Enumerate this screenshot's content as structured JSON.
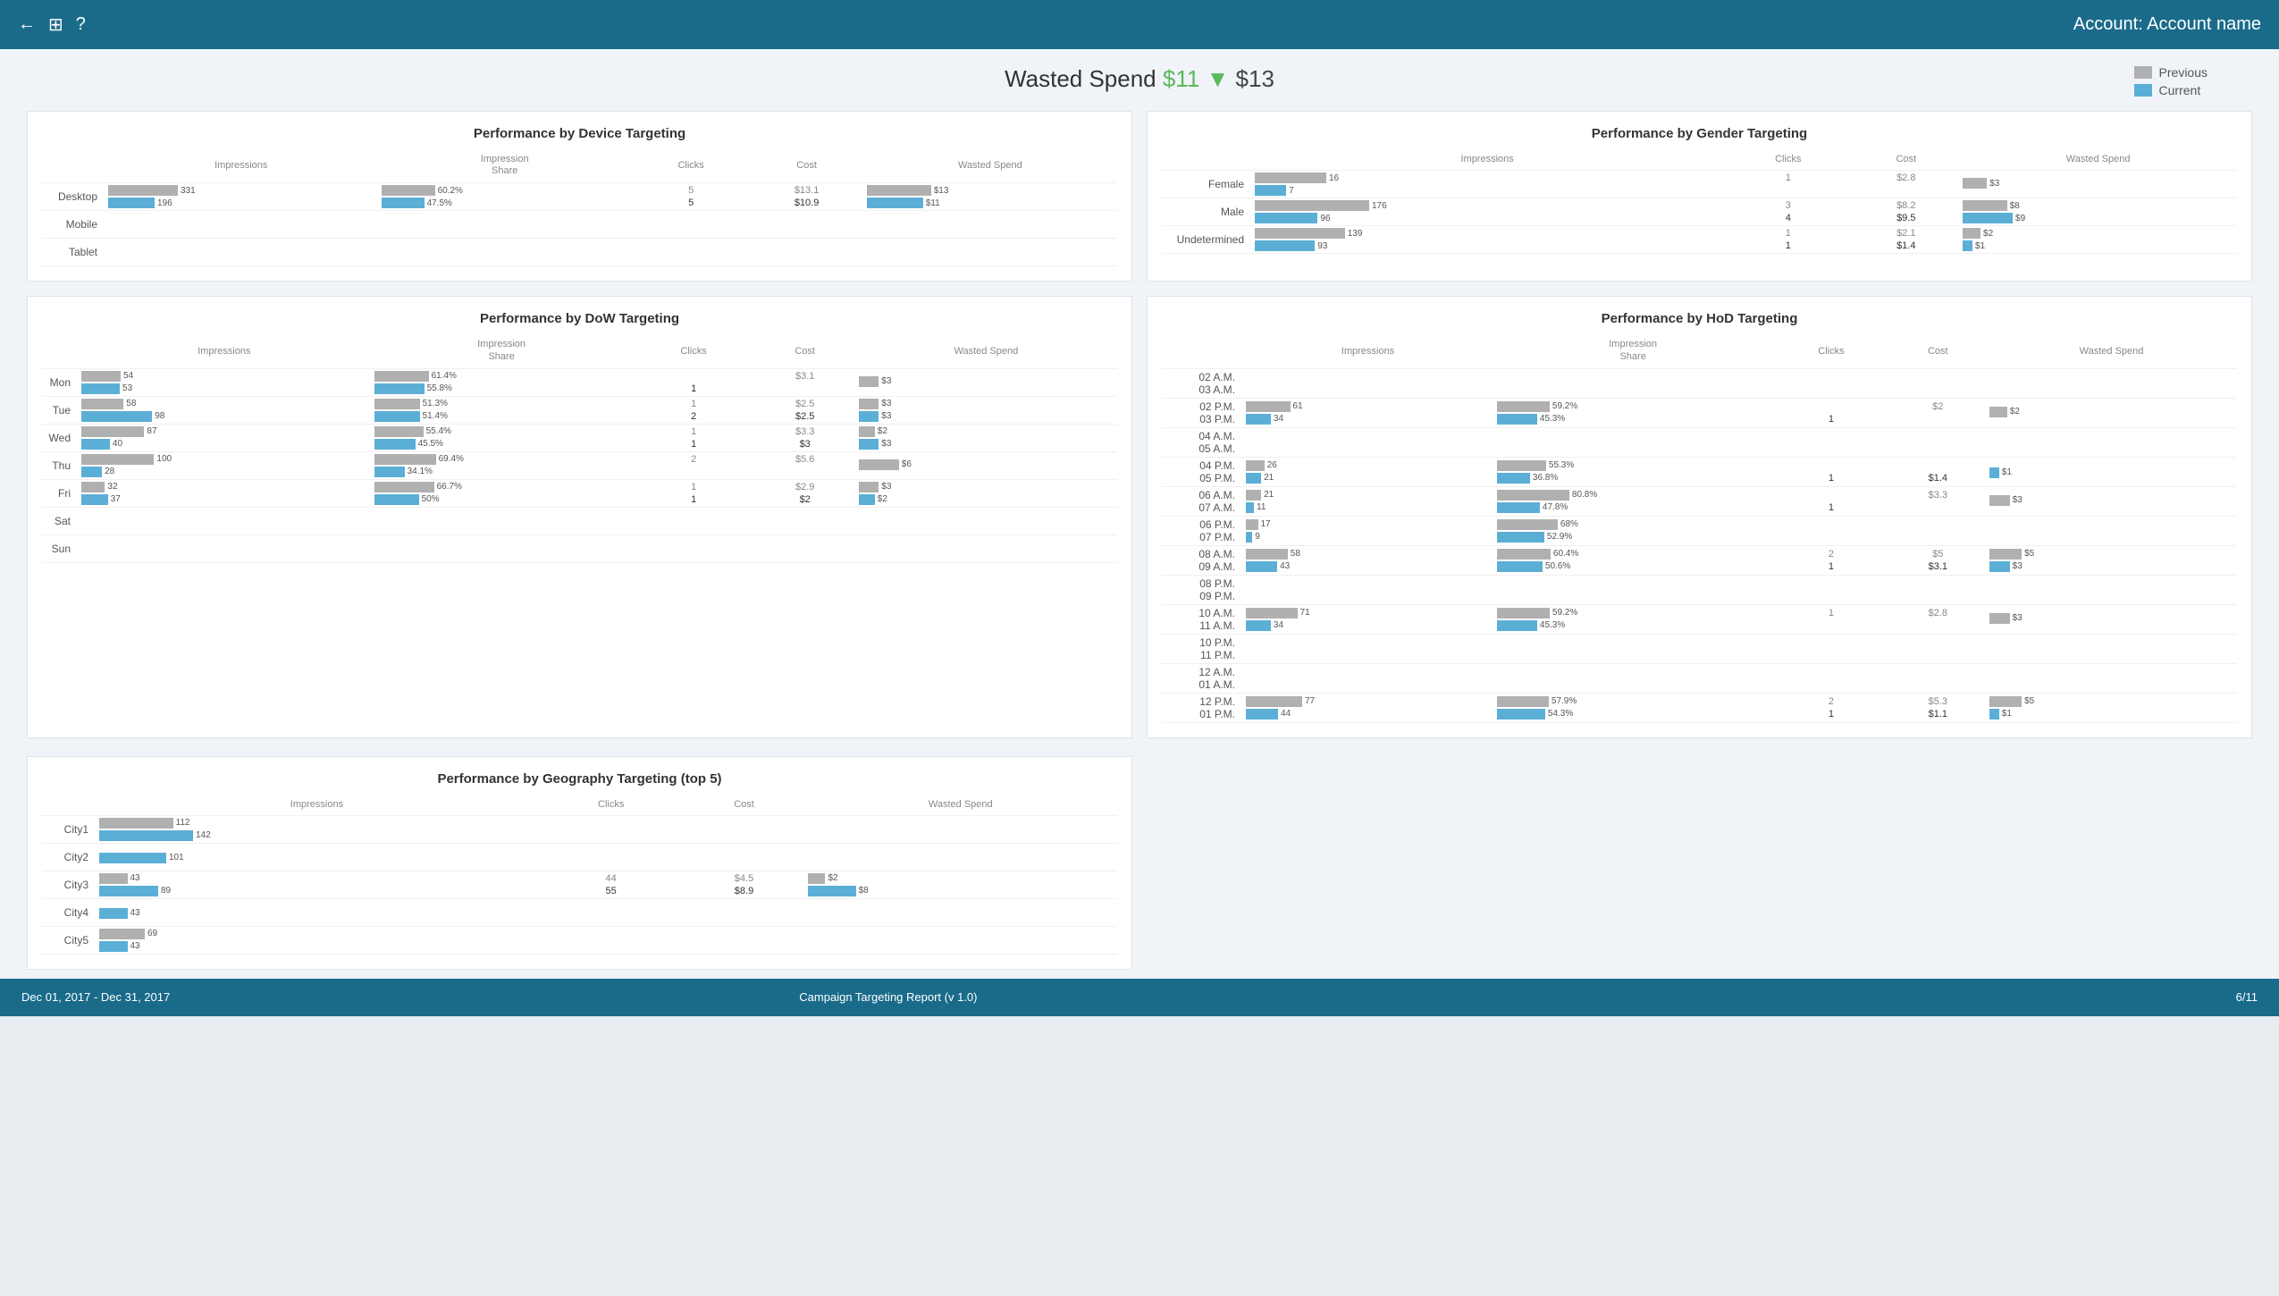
{
  "header": {
    "account_label": "Account: Account name"
  },
  "title": {
    "text_prefix": "Wasted Spend ",
    "amount_prev": "$11",
    "arrow": "▼",
    "amount_curr": "$13"
  },
  "legend": {
    "prev_label": "Previous",
    "curr_label": "Current"
  },
  "device_panel": {
    "title": "Performance by Device Targeting",
    "col_impressions": "Impressions",
    "col_imp_share": "Impression Share",
    "col_clicks": "Clicks",
    "col_cost": "Cost",
    "col_wasted": "Wasted Spend",
    "rows": [
      {
        "label": "Desktop",
        "imp_prev": 331,
        "imp_curr": 196,
        "imp_prev_pct": 60,
        "imp_curr_pct": 40,
        "imp_share_prev": "60.2%",
        "imp_share_curr": "47.5%",
        "imp_share_prev_pct": 60,
        "imp_share_curr_pct": 48,
        "clicks_prev": "5",
        "clicks_curr": "5",
        "cost_prev": "$13.1",
        "cost_curr": "$10.9",
        "wasted_prev": "$13",
        "wasted_curr": "$11",
        "wasted_prev_pct": 80,
        "wasted_curr_pct": 70
      },
      {
        "label": "Mobile",
        "imp_prev": 0,
        "imp_curr": 0,
        "imp_prev_pct": 0,
        "imp_curr_pct": 0,
        "imp_share_prev": "",
        "imp_share_curr": "",
        "imp_share_prev_pct": 0,
        "imp_share_curr_pct": 0,
        "clicks_prev": "",
        "clicks_curr": "",
        "cost_prev": "",
        "cost_curr": "",
        "wasted_prev": "",
        "wasted_curr": "",
        "wasted_prev_pct": 0,
        "wasted_curr_pct": 0
      },
      {
        "label": "Tablet",
        "imp_prev": 0,
        "imp_curr": 0,
        "imp_prev_pct": 0,
        "imp_curr_pct": 0,
        "imp_share_prev": "",
        "imp_share_curr": "",
        "imp_share_prev_pct": 0,
        "imp_share_curr_pct": 0,
        "clicks_prev": "",
        "clicks_curr": "",
        "cost_prev": "",
        "cost_curr": "",
        "wasted_prev": "",
        "wasted_curr": "",
        "wasted_prev_pct": 0,
        "wasted_curr_pct": 0
      }
    ]
  },
  "gender_panel": {
    "title": "Performance by Gender Targeting",
    "col_impressions": "Impressions",
    "col_clicks": "Clicks",
    "col_cost": "Cost",
    "col_wasted": "Wasted Spend",
    "rows": [
      {
        "label": "Female",
        "imp_prev": 16,
        "imp_curr": 7,
        "imp_prev_pct": 50,
        "imp_curr_pct": 22,
        "clicks_prev": "1",
        "clicks_curr": "",
        "cost_prev": "$2.8",
        "cost_curr": "",
        "wasted_prev": "$3",
        "wasted_curr": "",
        "wasted_prev_pct": 30,
        "wasted_curr_pct": 0
      },
      {
        "label": "Male",
        "imp_prev": 176,
        "imp_curr": 96,
        "imp_prev_pct": 80,
        "imp_curr_pct": 44,
        "clicks_prev": "3",
        "clicks_curr": "4",
        "cost_prev": "$8.2",
        "cost_curr": "$9.5",
        "wasted_prev": "$8",
        "wasted_curr": "$9",
        "wasted_prev_pct": 55,
        "wasted_curr_pct": 62
      },
      {
        "label": "Undetermined",
        "imp_prev": 139,
        "imp_curr": 93,
        "imp_prev_pct": 63,
        "imp_curr_pct": 42,
        "clicks_prev": "1",
        "clicks_curr": "1",
        "cost_prev": "$2.1",
        "cost_curr": "$1.4",
        "wasted_prev": "$2",
        "wasted_curr": "$1",
        "wasted_prev_pct": 22,
        "wasted_curr_pct": 12
      }
    ]
  },
  "dow_panel": {
    "title": "Performance by DoW Targeting",
    "col_impressions": "Impressions",
    "col_imp_share": "Impression Share",
    "col_clicks": "Clicks",
    "col_cost": "Cost",
    "col_wasted": "Wasted Spend",
    "rows": [
      {
        "label": "Mon",
        "imp_prev": 54,
        "imp_curr": 53,
        "imp_prev_pct": 40,
        "imp_curr_pct": 39,
        "imp_share_prev": "61.4%",
        "imp_share_curr": "55.8%",
        "imp_share_prev_pct": 61,
        "imp_share_curr_pct": 56,
        "clicks_prev": "",
        "clicks_curr": "1",
        "cost_prev": "$3.1",
        "cost_curr": "",
        "wasted_prev": "$3",
        "wasted_curr": "",
        "wasted_prev_pct": 25,
        "wasted_curr_pct": 0
      },
      {
        "label": "Tue",
        "imp_prev": 58,
        "imp_curr": 98,
        "imp_prev_pct": 43,
        "imp_curr_pct": 72,
        "imp_share_prev": "51.3%",
        "imp_share_curr": "51.4%",
        "imp_share_prev_pct": 51,
        "imp_share_curr_pct": 51,
        "clicks_prev": "1",
        "clicks_curr": "2",
        "cost_prev": "$2.5",
        "cost_curr": "$2.5",
        "wasted_prev": "$3",
        "wasted_curr": "$3",
        "wasted_prev_pct": 25,
        "wasted_curr_pct": 25
      },
      {
        "label": "Wed",
        "imp_prev": 87,
        "imp_curr": 40,
        "imp_prev_pct": 64,
        "imp_curr_pct": 29,
        "imp_share_prev": "55.4%",
        "imp_share_curr": "45.5%",
        "imp_share_prev_pct": 55,
        "imp_share_curr_pct": 46,
        "clicks_prev": "1",
        "clicks_curr": "1",
        "cost_prev": "$3.3",
        "cost_curr": "$3",
        "wasted_prev": "$2",
        "wasted_curr": "$3",
        "wasted_prev_pct": 20,
        "wasted_curr_pct": 25
      },
      {
        "label": "Thu",
        "imp_prev": 100,
        "imp_curr": 28,
        "imp_prev_pct": 74,
        "imp_curr_pct": 21,
        "imp_share_prev": "69.4%",
        "imp_share_curr": "34.1%",
        "imp_share_prev_pct": 69,
        "imp_share_curr_pct": 34,
        "clicks_prev": "2",
        "clicks_curr": "",
        "cost_prev": "$5.6",
        "cost_curr": "",
        "wasted_prev": "$6",
        "wasted_curr": "",
        "wasted_prev_pct": 50,
        "wasted_curr_pct": 0
      },
      {
        "label": "Fri",
        "imp_prev": 32,
        "imp_curr": 37,
        "imp_prev_pct": 24,
        "imp_curr_pct": 27,
        "imp_share_prev": "66.7%",
        "imp_share_curr": "50%",
        "imp_share_prev_pct": 67,
        "imp_share_curr_pct": 50,
        "clicks_prev": "1",
        "clicks_curr": "1",
        "cost_prev": "$2.9",
        "cost_curr": "$2",
        "wasted_prev": "$3",
        "wasted_curr": "$2",
        "wasted_prev_pct": 25,
        "wasted_curr_pct": 20
      },
      {
        "label": "Sat",
        "imp_prev": 0,
        "imp_curr": 0,
        "imp_prev_pct": 0,
        "imp_curr_pct": 0,
        "imp_share_prev": "",
        "imp_share_curr": "",
        "imp_share_prev_pct": 0,
        "imp_share_curr_pct": 0,
        "clicks_prev": "",
        "clicks_curr": "",
        "cost_prev": "",
        "cost_curr": "",
        "wasted_prev": "",
        "wasted_curr": "",
        "wasted_prev_pct": 0,
        "wasted_curr_pct": 0
      },
      {
        "label": "Sun",
        "imp_prev": 0,
        "imp_curr": 0,
        "imp_prev_pct": 0,
        "imp_curr_pct": 0,
        "imp_share_prev": "",
        "imp_share_curr": "",
        "imp_share_prev_pct": 0,
        "imp_share_curr_pct": 0,
        "clicks_prev": "",
        "clicks_curr": "",
        "cost_prev": "",
        "cost_curr": "",
        "wasted_prev": "",
        "wasted_curr": "",
        "wasted_prev_pct": 0,
        "wasted_curr_pct": 0
      }
    ]
  },
  "hod_panel": {
    "title": "Performance by HoD Targeting",
    "col_impressions": "Impressions",
    "col_imp_share": "Impression Share",
    "col_clicks": "Clicks",
    "col_cost": "Cost",
    "col_wasted": "Wasted Spend",
    "rows": [
      {
        "label": "02 A.M. -- 03 A.M.",
        "imp_prev": 0,
        "imp_curr": 0,
        "imp_prev_pct": 0,
        "imp_curr_pct": 0,
        "imp_share_prev": "",
        "imp_share_curr": "",
        "imp_share_prev_pct": 0,
        "imp_share_curr_pct": 0,
        "clicks_prev": "",
        "clicks_curr": "",
        "cost_prev": "",
        "cost_curr": "",
        "wasted_prev": "",
        "wasted_curr": "",
        "wasted_prev_pct": 0,
        "wasted_curr_pct": 0
      },
      {
        "label": "02 P.M. -- 03 P.M.",
        "imp_prev": 61,
        "imp_curr": 34,
        "imp_prev_pct": 55,
        "imp_curr_pct": 31,
        "imp_share_prev": "59.2%",
        "imp_share_curr": "45.3%",
        "imp_share_prev_pct": 59,
        "imp_share_curr_pct": 45,
        "clicks_prev": "",
        "clicks_curr": "1",
        "cost_prev": "$2",
        "cost_curr": "",
        "wasted_prev": "$2",
        "wasted_curr": "",
        "wasted_prev_pct": 22,
        "wasted_curr_pct": 0
      },
      {
        "label": "04 A.M. -- 05 A.M.",
        "imp_prev": 0,
        "imp_curr": 0,
        "imp_prev_pct": 0,
        "imp_curr_pct": 0,
        "imp_share_prev": "",
        "imp_share_curr": "",
        "imp_share_prev_pct": 0,
        "imp_share_curr_pct": 0,
        "clicks_prev": "",
        "clicks_curr": "",
        "cost_prev": "",
        "cost_curr": "",
        "wasted_prev": "",
        "wasted_curr": "",
        "wasted_prev_pct": 0,
        "wasted_curr_pct": 0
      },
      {
        "label": "04 P.M. -- 05 P.M.",
        "imp_prev": 26,
        "imp_curr": 21,
        "imp_prev_pct": 23,
        "imp_curr_pct": 19,
        "imp_share_prev": "55.3%",
        "imp_share_curr": "36.8%",
        "imp_share_prev_pct": 55,
        "imp_share_curr_pct": 37,
        "clicks_prev": "",
        "clicks_curr": "1",
        "cost_prev": "",
        "cost_curr": "$1.4",
        "wasted_prev": "",
        "wasted_curr": "$1",
        "wasted_prev_pct": 0,
        "wasted_curr_pct": 12
      },
      {
        "label": "06 A.M. -- 07 A.M.",
        "imp_prev": 21,
        "imp_curr": 11,
        "imp_prev_pct": 19,
        "imp_curr_pct": 10,
        "imp_share_prev": "80.8%",
        "imp_share_curr": "47.8%",
        "imp_share_prev_pct": 81,
        "imp_share_curr_pct": 48,
        "clicks_prev": "",
        "clicks_curr": "1",
        "cost_prev": "$3.3",
        "cost_curr": "",
        "wasted_prev": "$3",
        "wasted_curr": "",
        "wasted_prev_pct": 25,
        "wasted_curr_pct": 0
      },
      {
        "label": "06 P.M. -- 07 P.M.",
        "imp_prev": 17,
        "imp_curr": 9,
        "imp_prev_pct": 15,
        "imp_curr_pct": 8,
        "imp_share_prev": "68%",
        "imp_share_curr": "52.9%",
        "imp_share_prev_pct": 68,
        "imp_share_curr_pct": 53,
        "clicks_prev": "",
        "clicks_curr": "",
        "cost_prev": "",
        "cost_curr": "",
        "wasted_prev": "",
        "wasted_curr": "",
        "wasted_prev_pct": 0,
        "wasted_curr_pct": 0
      },
      {
        "label": "08 A.M. -- 09 A.M.",
        "imp_prev": 58,
        "imp_curr": 43,
        "imp_prev_pct": 52,
        "imp_curr_pct": 39,
        "imp_share_prev": "60.4%",
        "imp_share_curr": "50.6%",
        "imp_share_prev_pct": 60,
        "imp_share_curr_pct": 51,
        "clicks_prev": "2",
        "clicks_curr": "1",
        "cost_prev": "$5",
        "cost_curr": "$3.1",
        "wasted_prev": "$5",
        "wasted_curr": "$3",
        "wasted_prev_pct": 40,
        "wasted_curr_pct": 25
      },
      {
        "label": "08 P.M. -- 09 P.M.",
        "imp_prev": 0,
        "imp_curr": 0,
        "imp_prev_pct": 0,
        "imp_curr_pct": 0,
        "imp_share_prev": "",
        "imp_share_curr": "",
        "imp_share_prev_pct": 0,
        "imp_share_curr_pct": 0,
        "clicks_prev": "",
        "clicks_curr": "",
        "cost_prev": "",
        "cost_curr": "",
        "wasted_prev": "",
        "wasted_curr": "",
        "wasted_prev_pct": 0,
        "wasted_curr_pct": 0
      },
      {
        "label": "10 A.M. -- 11 A.M.",
        "imp_prev": 71,
        "imp_curr": 34,
        "imp_prev_pct": 64,
        "imp_curr_pct": 31,
        "imp_share_prev": "59.2%",
        "imp_share_curr": "45.3%",
        "imp_share_prev_pct": 59,
        "imp_share_curr_pct": 45,
        "clicks_prev": "1",
        "clicks_curr": "",
        "cost_prev": "$2.8",
        "cost_curr": "",
        "wasted_prev": "$3",
        "wasted_curr": "",
        "wasted_prev_pct": 25,
        "wasted_curr_pct": 0
      },
      {
        "label": "10 P.M. -- 11 P.M.",
        "imp_prev": 0,
        "imp_curr": 0,
        "imp_prev_pct": 0,
        "imp_curr_pct": 0,
        "imp_share_prev": "",
        "imp_share_curr": "",
        "imp_share_prev_pct": 0,
        "imp_share_curr_pct": 0,
        "clicks_prev": "",
        "clicks_curr": "",
        "cost_prev": "",
        "cost_curr": "",
        "wasted_prev": "",
        "wasted_curr": "",
        "wasted_prev_pct": 0,
        "wasted_curr_pct": 0
      },
      {
        "label": "12 A.M. -- 01 A.M.",
        "imp_prev": 0,
        "imp_curr": 0,
        "imp_prev_pct": 0,
        "imp_curr_pct": 0,
        "imp_share_prev": "",
        "imp_share_curr": "",
        "imp_share_prev_pct": 0,
        "imp_share_curr_pct": 0,
        "clicks_prev": "",
        "clicks_curr": "",
        "cost_prev": "",
        "cost_curr": "",
        "wasted_prev": "",
        "wasted_curr": "",
        "wasted_prev_pct": 0,
        "wasted_curr_pct": 0
      },
      {
        "label": "12 P.M. -- 01 P.M.",
        "imp_prev": 77,
        "imp_curr": 44,
        "imp_prev_pct": 70,
        "imp_curr_pct": 40,
        "imp_share_prev": "57.9%",
        "imp_share_curr": "54.3%",
        "imp_share_prev_pct": 58,
        "imp_share_curr_pct": 54,
        "clicks_prev": "2",
        "clicks_curr": "1",
        "cost_prev": "$5.3",
        "cost_curr": "$1.1",
        "wasted_prev": "$5",
        "wasted_curr": "$1",
        "wasted_prev_pct": 40,
        "wasted_curr_pct": 12
      }
    ]
  },
  "geo_panel": {
    "title": "Performance by Geography Targeting (top 5)",
    "col_impressions": "Impressions",
    "col_clicks": "Clicks",
    "col_cost": "Cost",
    "col_wasted": "Wasted Spend",
    "rows": [
      {
        "label": "City1",
        "imp_prev": 112,
        "imp_curr": 142,
        "imp_prev_pct": 55,
        "imp_curr_pct": 70,
        "clicks_prev": "",
        "clicks_curr": "",
        "cost_prev": "",
        "cost_curr": "",
        "wasted_prev": "",
        "wasted_curr": "",
        "wasted_prev_pct": 0,
        "wasted_curr_pct": 0
      },
      {
        "label": "City2",
        "imp_prev": 0,
        "imp_curr": 101,
        "imp_prev_pct": 0,
        "imp_curr_pct": 50,
        "clicks_prev": "",
        "clicks_curr": "",
        "cost_prev": "",
        "cost_curr": "",
        "wasted_prev": "",
        "wasted_curr": "",
        "wasted_prev_pct": 0,
        "wasted_curr_pct": 0
      },
      {
        "label": "City3",
        "imp_prev": 43,
        "imp_curr": 89,
        "imp_prev_pct": 21,
        "imp_curr_pct": 44,
        "clicks_prev": "44",
        "clicks_curr": "55",
        "cost_prev": "$4.5",
        "cost_curr": "$8.9",
        "wasted_prev": "$2",
        "wasted_curr": "$8",
        "wasted_prev_pct": 22,
        "wasted_curr_pct": 60
      },
      {
        "label": "City4",
        "imp_prev": 0,
        "imp_curr": 43,
        "imp_prev_pct": 0,
        "imp_curr_pct": 21,
        "clicks_prev": "",
        "clicks_curr": "",
        "cost_prev": "",
        "cost_curr": "",
        "wasted_prev": "",
        "wasted_curr": "",
        "wasted_prev_pct": 0,
        "wasted_curr_pct": 0
      },
      {
        "label": "City5",
        "imp_prev": 69,
        "imp_curr": 43,
        "imp_prev_pct": 34,
        "imp_curr_pct": 21,
        "clicks_prev": "",
        "clicks_curr": "",
        "cost_prev": "",
        "cost_curr": "",
        "wasted_prev": "",
        "wasted_curr": "",
        "wasted_prev_pct": 0,
        "wasted_curr_pct": 0
      }
    ]
  },
  "footer": {
    "date_range": "Dec 01, 2017 - Dec 31, 2017",
    "report_title": "Campaign Targeting Report (v 1.0)",
    "page_info": "6/11"
  }
}
